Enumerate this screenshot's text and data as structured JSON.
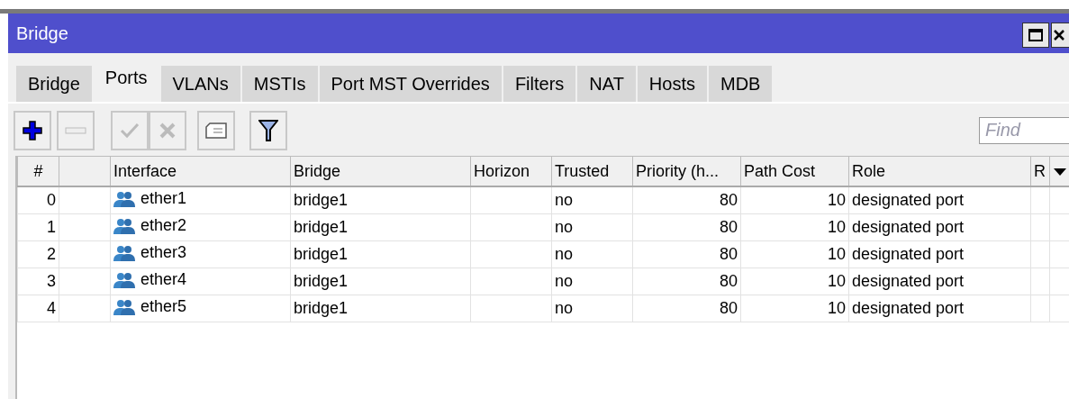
{
  "window": {
    "title": "Bridge"
  },
  "tabs": [
    {
      "label": "Bridge",
      "selected": false
    },
    {
      "label": "Ports",
      "selected": true
    },
    {
      "label": "VLANs",
      "selected": false
    },
    {
      "label": "MSTIs",
      "selected": false
    },
    {
      "label": "Port MST Overrides",
      "selected": false
    },
    {
      "label": "Filters",
      "selected": false
    },
    {
      "label": "NAT",
      "selected": false
    },
    {
      "label": "Hosts",
      "selected": false
    },
    {
      "label": "MDB",
      "selected": false
    }
  ],
  "toolbar": [
    {
      "kind": "add",
      "disabled": false
    },
    {
      "kind": "remove",
      "disabled": true
    },
    {
      "kind": "enable",
      "disabled": true
    },
    {
      "kind": "disable",
      "disabled": true
    },
    {
      "kind": "comment",
      "disabled": false
    },
    {
      "kind": "filter",
      "disabled": false
    }
  ],
  "search": {
    "placeholder": "Find"
  },
  "table": {
    "columns": [
      "#",
      "Interface",
      "Bridge",
      "Horizon",
      "Trusted",
      "Priority (h...",
      "Path Cost",
      "Role",
      "R"
    ],
    "rows": [
      {
        "index": "0",
        "interface": "ether1",
        "bridge": "bridge1",
        "trusted": "no",
        "priority": "80",
        "path_cost": "10",
        "role": "designated port"
      },
      {
        "index": "1",
        "interface": "ether2",
        "bridge": "bridge1",
        "trusted": "no",
        "priority": "80",
        "path_cost": "10",
        "role": "designated port"
      },
      {
        "index": "2",
        "interface": "ether3",
        "bridge": "bridge1",
        "trusted": "no",
        "priority": "80",
        "path_cost": "10",
        "role": "designated port"
      },
      {
        "index": "3",
        "interface": "ether4",
        "bridge": "bridge1",
        "trusted": "no",
        "priority": "80",
        "path_cost": "10",
        "role": "designated port"
      },
      {
        "index": "4",
        "interface": "ether5",
        "bridge": "bridge1",
        "trusted": "no",
        "priority": "80",
        "path_cost": "10",
        "role": "designated port"
      }
    ]
  }
}
